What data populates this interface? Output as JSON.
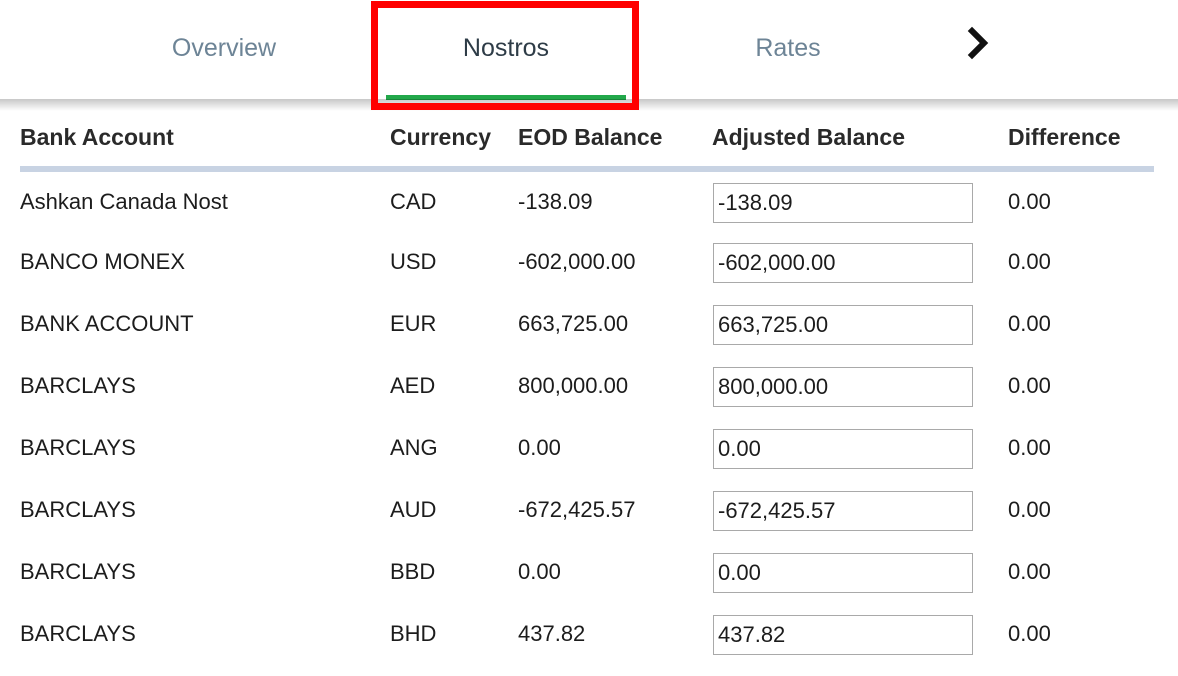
{
  "tabs": {
    "overview": "Overview",
    "nostros": "Nostros",
    "rates": "Rates",
    "next_icon": "chevron-right-icon"
  },
  "colors": {
    "active_tab_underline": "#22a84a",
    "highlight_box": "#ff0000",
    "inactive_tab_text": "#6d8496",
    "header_rule": "#c8d3e3"
  },
  "table": {
    "headers": {
      "bank_account": "Bank Account",
      "currency": "Currency",
      "eod_balance": "EOD Balance",
      "adjusted_balance": "Adjusted Balance",
      "difference": "Difference"
    },
    "rows": [
      {
        "bank": "Ashkan Canada Nost",
        "currency": "CAD",
        "eod": "-138.09",
        "adjusted": "-138.09",
        "difference": "0.00"
      },
      {
        "bank": "BANCO MONEX",
        "currency": "USD",
        "eod": "-602,000.00",
        "adjusted": "-602,000.00",
        "difference": "0.00"
      },
      {
        "bank": "BANK ACCOUNT",
        "currency": "EUR",
        "eod": "663,725.00",
        "adjusted": "663,725.00",
        "difference": "0.00"
      },
      {
        "bank": "BARCLAYS",
        "currency": "AED",
        "eod": "800,000.00",
        "adjusted": "800,000.00",
        "difference": "0.00"
      },
      {
        "bank": "BARCLAYS",
        "currency": "ANG",
        "eod": "0.00",
        "adjusted": "0.00",
        "difference": "0.00"
      },
      {
        "bank": "BARCLAYS",
        "currency": "AUD",
        "eod": "-672,425.57",
        "adjusted": "-672,425.57",
        "difference": "0.00"
      },
      {
        "bank": "BARCLAYS",
        "currency": "BBD",
        "eod": "0.00",
        "adjusted": "0.00",
        "difference": "0.00"
      },
      {
        "bank": "BARCLAYS",
        "currency": "BHD",
        "eod": "437.82",
        "adjusted": "437.82",
        "difference": "0.00"
      }
    ]
  }
}
